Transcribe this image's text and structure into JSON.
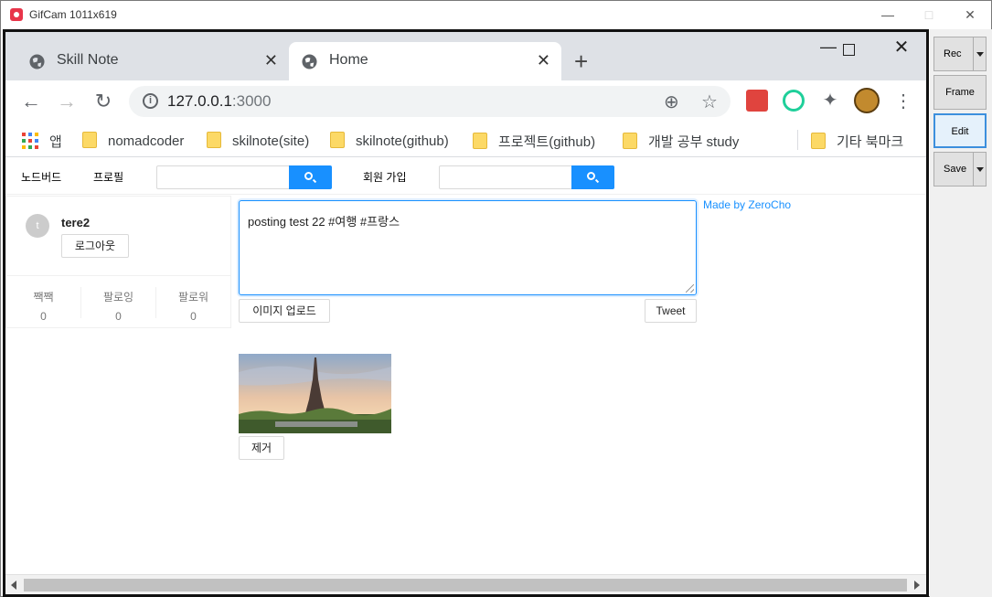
{
  "gifcam": {
    "title": "GifCam 1011x619",
    "buttons": [
      "Rec",
      "Frame",
      "Edit",
      "Save"
    ]
  },
  "browser": {
    "tabs": [
      {
        "title": "Skill Note",
        "active": false
      },
      {
        "title": "Home",
        "active": true
      }
    ],
    "url_host": "127.0.0.1",
    "url_port": ":3000",
    "bookmarks": [
      "앱",
      "nomadcoder",
      "skilnote(site)",
      "skilnote(github)",
      "프로젝트(github)",
      "개발 공부 study",
      "기타 북마크"
    ]
  },
  "app": {
    "menu": {
      "home": "노드버드",
      "profile": "프로필",
      "signup": "회원 가입"
    },
    "user": {
      "avatar_initial": "t",
      "nickname": "tere2",
      "logout": "로그아웃",
      "stats": [
        {
          "label": "짹짹",
          "value": "0"
        },
        {
          "label": "팔로잉",
          "value": "0"
        },
        {
          "label": "팔로워",
          "value": "0"
        }
      ]
    },
    "post_form": {
      "text": "posting test 22 #여행 #프랑스",
      "upload_button": "이미지 업로드",
      "tweet_button": "Tweet"
    },
    "credit": "Made by ZeroCho",
    "preview": {
      "remove_button": "제거"
    }
  },
  "colors": {
    "accent": "#1890ff",
    "capture_border": "#111111",
    "tabstrip": "#dee1e6"
  }
}
